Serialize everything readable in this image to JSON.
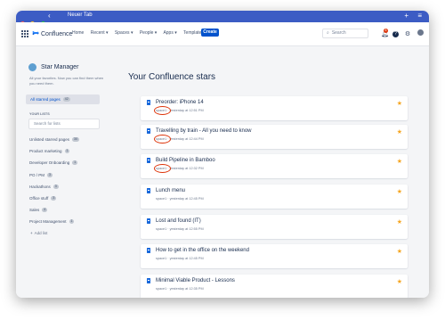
{
  "browser": {
    "tab_title": "Neuer Tab",
    "back_icon": "chevron-left-icon",
    "new_tab_icon": "plus-icon",
    "menu_icon": "menu-icon",
    "dots": [
      "#ff5f57",
      "#febc2e",
      "#28c840"
    ]
  },
  "nav": {
    "logo": "Confluence",
    "items": [
      "Home",
      "Recent ▾",
      "Spaces ▾",
      "People ▾",
      "Apps ▾",
      "Templates"
    ],
    "create": "Create",
    "search_placeholder": "Search",
    "notification_count": "8"
  },
  "sidebar": {
    "title": "Star Manager",
    "description": "All your favorites. Now you can find them when you need them.",
    "all_starred_label": "All starred pages",
    "all_starred_count": "42",
    "your_lists_label": "YOUR LISTS",
    "search_placeholder": "Search for lists",
    "lists": [
      {
        "label": "Unlisted starred pages",
        "count": "30"
      },
      {
        "label": "Product marketing",
        "count": "1"
      },
      {
        "label": "Developer Onboarding",
        "count": "1"
      },
      {
        "label": "PO / PM",
        "count": "3"
      },
      {
        "label": "Hackathons",
        "count": "3"
      },
      {
        "label": "Office stuff",
        "count": "3"
      },
      {
        "label": "Sales",
        "count": "4"
      },
      {
        "label": "Project Management",
        "count": "1"
      }
    ],
    "add_list": "Add list"
  },
  "main": {
    "title": "Your Confluence stars",
    "cards": [
      {
        "title": "Preorder: iPhone 14",
        "meta": "space1 · yesterday at 12:51 PM",
        "highlighted": true
      },
      {
        "title": "Travelling by train - All you need to know",
        "meta": "space1 · yesterday at 12:44 PM",
        "highlighted": true
      },
      {
        "title": "Build Pipeline in Bamboo",
        "meta": "space1 · yesterday at 12:32 PM",
        "highlighted": true
      },
      {
        "title": "Lunch menu",
        "meta": "space1 · yesterday at 12:45 PM",
        "highlighted": false
      },
      {
        "title": "Lost and found (IT)",
        "meta": "space1 · yesterday at 12:55 PM",
        "highlighted": false
      },
      {
        "title": "How to get in the office on the weekend",
        "meta": "space1 · yesterday at 12:45 PM",
        "highlighted": false
      },
      {
        "title": "Minimal Viable Product - Lessons",
        "meta": "space1 · yesterday at 12:35 PM",
        "highlighted": false
      }
    ]
  },
  "colors": {
    "accent": "#0052cc",
    "star": "#f5a623",
    "highlight_circle": "#de350b",
    "titlebar": "#3c5cc4"
  }
}
